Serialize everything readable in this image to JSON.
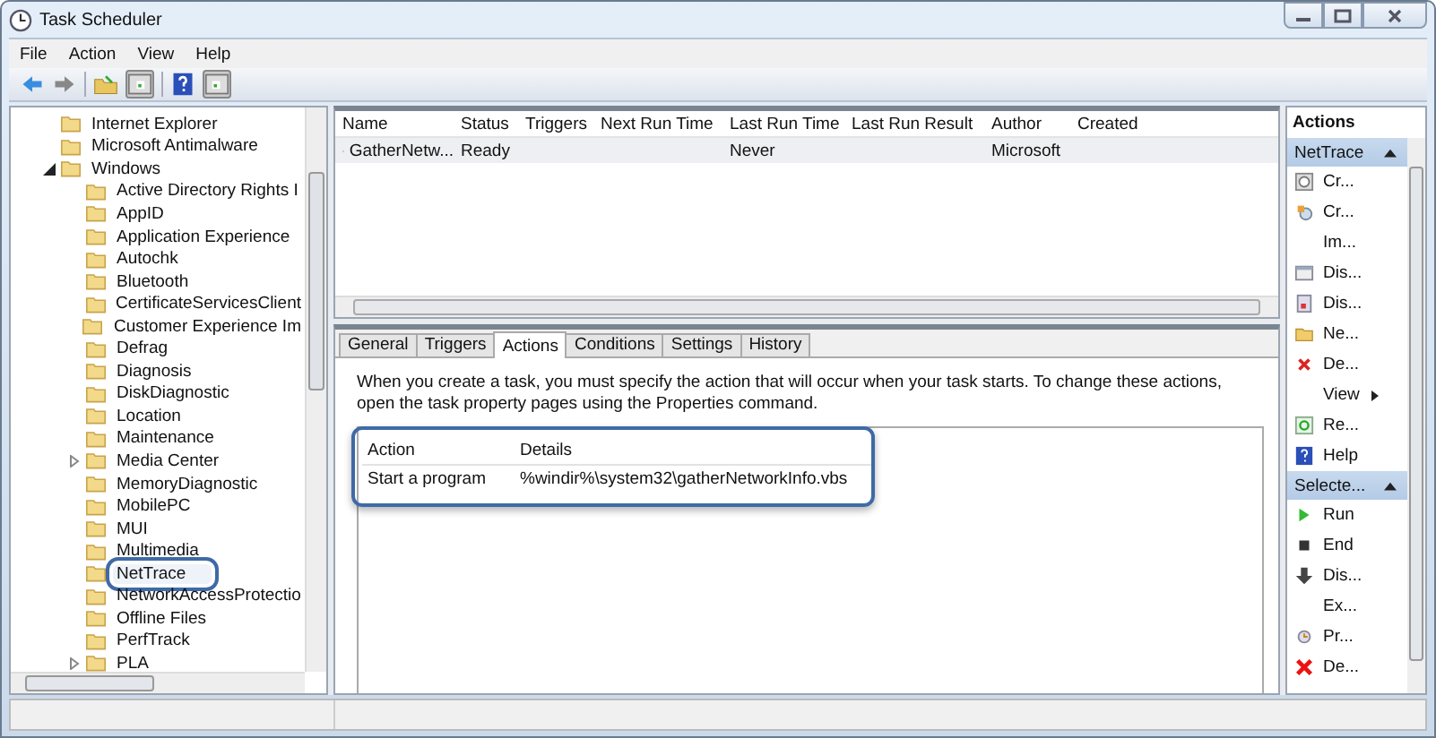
{
  "window": {
    "title": "Task Scheduler"
  },
  "menu": [
    "File",
    "Action",
    "View",
    "Help"
  ],
  "tree": [
    {
      "label": "Internet Explorer",
      "selected": false
    },
    {
      "label": "Microsoft Antimalware",
      "selected": false
    },
    {
      "label": "Windows",
      "expanded": true,
      "selected": false,
      "children": [
        {
          "label": "Active Directory Rights I",
          "selected": false
        },
        {
          "label": "AppID",
          "selected": false
        },
        {
          "label": "Application Experience",
          "selected": false
        },
        {
          "label": "Autochk",
          "selected": false
        },
        {
          "label": "Bluetooth",
          "selected": false
        },
        {
          "label": "CertificateServicesClient",
          "selected": false
        },
        {
          "label": "Customer Experience Im",
          "selected": false
        },
        {
          "label": "Defrag",
          "selected": false
        },
        {
          "label": "Diagnosis",
          "selected": false
        },
        {
          "label": "DiskDiagnostic",
          "selected": false
        },
        {
          "label": "Location",
          "selected": false
        },
        {
          "label": "Maintenance",
          "selected": false
        },
        {
          "label": "Media Center",
          "expanded": false,
          "selected": false
        },
        {
          "label": "MemoryDiagnostic",
          "selected": false
        },
        {
          "label": "MobilePC",
          "selected": false
        },
        {
          "label": "MUI",
          "selected": false
        },
        {
          "label": "Multimedia",
          "selected": false
        },
        {
          "label": "NetTrace",
          "selected": true
        },
        {
          "label": "NetworkAccessProtectio",
          "selected": false
        },
        {
          "label": "Offline Files",
          "selected": false
        },
        {
          "label": "PerfTrack",
          "selected": false
        },
        {
          "label": "PLA",
          "expanded": false,
          "selected": false
        }
      ]
    }
  ],
  "task_list": {
    "columns": [
      "Name",
      "Status",
      "Triggers",
      "Next Run Time",
      "Last Run Time",
      "Last Run Result",
      "Author",
      "Created"
    ],
    "rows": [
      {
        "selected": true,
        "cells": [
          "GatherNetw...",
          "Ready",
          "",
          "",
          "Never",
          "",
          "Microsoft",
          ""
        ]
      }
    ]
  },
  "tabs": [
    {
      "label": "General",
      "selected": false
    },
    {
      "label": "Triggers",
      "selected": false
    },
    {
      "label": "Actions",
      "selected": true
    },
    {
      "label": "Conditions",
      "selected": false
    },
    {
      "label": "Settings",
      "selected": false
    },
    {
      "label": "History",
      "selected": false
    }
  ],
  "actions_tab": {
    "description": "When you create a task, you must specify the action that will occur when your task starts.  To change these actions, open the task property pages using the Properties command.",
    "highlighted": true,
    "columns": [
      "Action",
      "Details"
    ],
    "rows": [
      [
        "Start a program",
        "%windir%\\system32\\gatherNetworkInfo.vbs"
      ]
    ]
  },
  "actions_pane": {
    "title": "Actions",
    "sections": [
      {
        "title": "NetTrace",
        "items": [
          "Cr...",
          "Cr...",
          "Im...",
          "Dis...",
          "Dis...",
          "Ne...",
          "De...",
          "View",
          "Re...",
          "Help"
        ]
      },
      {
        "title": "Selecte...",
        "items": [
          "Run",
          "End",
          "Dis...",
          "Ex...",
          "Pr...",
          "De..."
        ]
      }
    ]
  }
}
